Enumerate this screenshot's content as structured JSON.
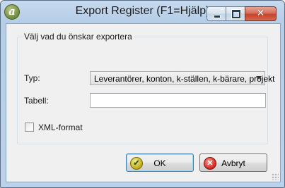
{
  "window": {
    "title": "Export Register (F1=Hjälp)",
    "app_icon_letter": "a",
    "buttons": {
      "minimize": "minimize",
      "maximize": "maximize",
      "close": "✕"
    }
  },
  "group": {
    "legend": "Välj vad du önskar exportera"
  },
  "form": {
    "typ_label": "Typ:",
    "typ_value": "Leverantörer, konton, k-ställen, k-bärare, projekt",
    "tabell_label": "Tabell:",
    "tabell_value": "",
    "xml_label": "XML-format",
    "xml_checked": false
  },
  "actions": {
    "ok_label": "OK",
    "cancel_label": "Avbryt"
  },
  "colors": {
    "titlebar": "#bcd2ea",
    "client": "#f0f0f0",
    "close_button": "#c5432b"
  }
}
